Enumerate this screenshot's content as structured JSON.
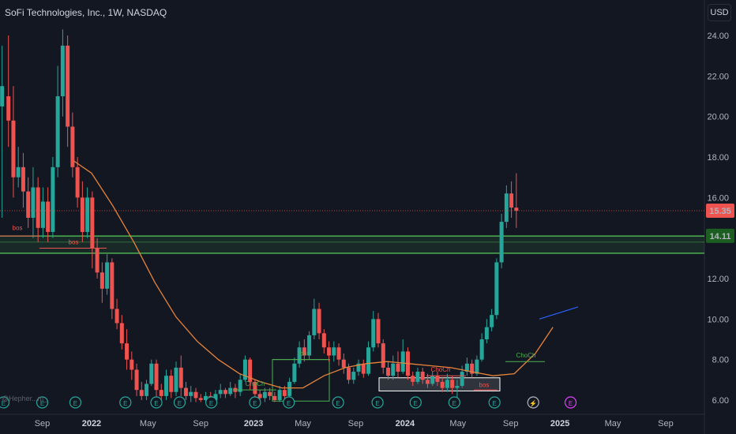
{
  "header": {
    "title": "SoFi Technologies, Inc., 1W, NASDAQ",
    "currency": "USD"
  },
  "watermark": "@Hepher...m_",
  "colors": {
    "background": "#131722",
    "up": "#26a69a",
    "down": "#ef5350",
    "ma": "#e8843a",
    "zone": "#4caf50",
    "price_line": "#ef5350"
  },
  "chart_data": {
    "type": "candlestick",
    "title": "SoFi Technologies, Inc., 1W, NASDAQ",
    "ylabel": "USD",
    "ylim": [
      5.8,
      25
    ],
    "y_ticks": [
      "24.00",
      "22.00",
      "20.00",
      "18.00",
      "16.00",
      "14.00",
      "12.00",
      "10.00",
      "8.00",
      "6.00"
    ],
    "x_ticks": [
      {
        "label": "Sep",
        "t": 0.06
      },
      {
        "label": "2022",
        "t": 0.13,
        "year": true
      },
      {
        "label": "May",
        "t": 0.21
      },
      {
        "label": "Sep",
        "t": 0.285
      },
      {
        "label": "2023",
        "t": 0.36,
        "year": true
      },
      {
        "label": "May",
        "t": 0.43
      },
      {
        "label": "Sep",
        "t": 0.505
      },
      {
        "label": "2024",
        "t": 0.575,
        "year": true
      },
      {
        "label": "May",
        "t": 0.65
      },
      {
        "label": "Sep",
        "t": 0.725
      },
      {
        "label": "2025",
        "t": 0.795,
        "year": true
      },
      {
        "label": "May",
        "t": 0.87
      },
      {
        "label": "Sep",
        "t": 0.945
      }
    ],
    "last_price": "15.35",
    "level_price": "14.11",
    "levels": [
      {
        "label": "15.35",
        "value": 15.35,
        "color": "#ef5350"
      },
      {
        "label": "14.11",
        "value": 14.11,
        "color": "#1b5e20"
      }
    ],
    "zone": {
      "from": 13.25,
      "to": 14.1
    },
    "annotations": [
      "bos",
      "bos",
      "ChoCh",
      "bos",
      "ChoCh",
      "ChoCh",
      "bos"
    ],
    "earnings_marker": "E",
    "ma": {
      "name": "",
      "points": [
        [
          0.105,
          17.8
        ],
        [
          0.13,
          17.2
        ],
        [
          0.16,
          15.6
        ],
        [
          0.19,
          13.8
        ],
        [
          0.22,
          11.8
        ],
        [
          0.25,
          10.1
        ],
        [
          0.28,
          8.9
        ],
        [
          0.31,
          8.0
        ],
        [
          0.34,
          7.3
        ],
        [
          0.37,
          6.9
        ],
        [
          0.4,
          6.6
        ],
        [
          0.43,
          6.6
        ],
        [
          0.46,
          7.2
        ],
        [
          0.49,
          7.6
        ],
        [
          0.52,
          7.8
        ],
        [
          0.55,
          7.9
        ],
        [
          0.58,
          7.8
        ],
        [
          0.61,
          7.7
        ],
        [
          0.64,
          7.6
        ],
        [
          0.67,
          7.4
        ],
        [
          0.7,
          7.2
        ],
        [
          0.73,
          7.3
        ],
        [
          0.76,
          8.3
        ],
        [
          0.785,
          9.6
        ]
      ]
    },
    "candles": [
      [
        0.003,
        20.5,
        21.5,
        15.0,
        23.5
      ],
      [
        0.012,
        21.0,
        19.8,
        18.5,
        24.0
      ],
      [
        0.019,
        19.8,
        17.0,
        16.0,
        21.5
      ],
      [
        0.026,
        17.0,
        17.5,
        16.5,
        18.5
      ],
      [
        0.033,
        17.5,
        16.3,
        15.5,
        18.2
      ],
      [
        0.04,
        16.3,
        15.0,
        14.5,
        17.0
      ],
      [
        0.047,
        15.0,
        16.5,
        14.0,
        17.5
      ],
      [
        0.054,
        16.5,
        14.5,
        13.8,
        17.0
      ],
      [
        0.061,
        14.5,
        15.8,
        14.0,
        16.5
      ],
      [
        0.068,
        15.8,
        14.3,
        13.8,
        16.5
      ],
      [
        0.075,
        14.3,
        17.5,
        14.0,
        18.0
      ],
      [
        0.082,
        17.5,
        21.0,
        17.0,
        22.5
      ],
      [
        0.089,
        21.0,
        23.5,
        20.0,
        24.3
      ],
      [
        0.096,
        23.5,
        19.5,
        18.5,
        24.0
      ],
      [
        0.103,
        19.5,
        17.5,
        17.0,
        20.2
      ],
      [
        0.11,
        17.5,
        16.0,
        15.5,
        18.0
      ],
      [
        0.117,
        16.0,
        14.3,
        13.8,
        16.8
      ],
      [
        0.124,
        14.3,
        16.0,
        14.0,
        16.5
      ],
      [
        0.131,
        16.0,
        13.5,
        12.5,
        16.3
      ],
      [
        0.138,
        13.5,
        12.3,
        12.0,
        14.0
      ],
      [
        0.145,
        12.3,
        11.5,
        10.8,
        12.8
      ],
      [
        0.152,
        11.5,
        12.8,
        11.2,
        13.2
      ],
      [
        0.159,
        12.8,
        10.5,
        10.0,
        13.0
      ],
      [
        0.166,
        10.5,
        9.8,
        9.5,
        11.0
      ],
      [
        0.173,
        9.8,
        8.8,
        8.5,
        10.2
      ],
      [
        0.18,
        8.8,
        8.0,
        7.5,
        9.5
      ],
      [
        0.187,
        8.0,
        7.5,
        7.0,
        8.4
      ],
      [
        0.194,
        7.5,
        6.5,
        6.2,
        7.8
      ],
      [
        0.201,
        6.5,
        6.2,
        6.0,
        6.9
      ],
      [
        0.208,
        6.2,
        6.8,
        6.0,
        7.0
      ],
      [
        0.215,
        6.8,
        7.8,
        6.7,
        8.0
      ],
      [
        0.222,
        7.8,
        6.5,
        6.1,
        8.0
      ],
      [
        0.229,
        6.5,
        6.2,
        6.0,
        6.8
      ],
      [
        0.236,
        6.2,
        7.2,
        6.0,
        7.5
      ],
      [
        0.243,
        7.2,
        6.4,
        6.1,
        7.5
      ],
      [
        0.25,
        6.4,
        7.6,
        6.2,
        7.9
      ],
      [
        0.257,
        7.6,
        6.6,
        6.2,
        8.2
      ],
      [
        0.264,
        6.6,
        6.2,
        6.0,
        6.9
      ],
      [
        0.271,
        6.2,
        6.4,
        5.9,
        6.7
      ],
      [
        0.278,
        6.4,
        6.1,
        5.9,
        6.6
      ],
      [
        0.285,
        6.1,
        6.0,
        5.9,
        6.3
      ],
      [
        0.292,
        6.0,
        6.2,
        5.9,
        6.4
      ],
      [
        0.299,
        6.2,
        6.0,
        5.9,
        6.4
      ],
      [
        0.306,
        6.0,
        6.3,
        5.9,
        6.5
      ],
      [
        0.313,
        6.3,
        6.5,
        6.1,
        6.8
      ],
      [
        0.32,
        6.5,
        6.3,
        6.1,
        6.6
      ],
      [
        0.327,
        6.3,
        6.6,
        6.2,
        6.9
      ],
      [
        0.334,
        6.6,
        6.4,
        6.1,
        6.8
      ],
      [
        0.341,
        6.4,
        7.0,
        6.2,
        7.3
      ],
      [
        0.348,
        7.0,
        8.0,
        6.9,
        8.2
      ],
      [
        0.355,
        8.0,
        6.9,
        6.5,
        8.1
      ],
      [
        0.362,
        6.9,
        6.3,
        6.0,
        7.0
      ],
      [
        0.369,
        6.3,
        6.1,
        5.9,
        6.5
      ],
      [
        0.376,
        6.1,
        6.4,
        5.9,
        6.6
      ],
      [
        0.383,
        6.4,
        6.2,
        6.0,
        6.6
      ],
      [
        0.39,
        6.2,
        6.0,
        5.9,
        6.4
      ],
      [
        0.397,
        6.0,
        6.5,
        5.9,
        6.7
      ],
      [
        0.404,
        6.5,
        6.2,
        6.0,
        6.7
      ],
      [
        0.411,
        6.2,
        6.9,
        6.1,
        7.1
      ],
      [
        0.418,
        6.9,
        7.8,
        6.8,
        8.1
      ],
      [
        0.425,
        7.8,
        8.6,
        7.6,
        8.9
      ],
      [
        0.432,
        8.6,
        8.2,
        7.9,
        9.0
      ],
      [
        0.439,
        8.2,
        9.2,
        8.0,
        9.4
      ],
      [
        0.446,
        9.2,
        10.5,
        9.0,
        11.0
      ],
      [
        0.453,
        10.5,
        9.3,
        9.0,
        10.8
      ],
      [
        0.46,
        9.3,
        8.6,
        8.3,
        9.5
      ],
      [
        0.467,
        8.6,
        8.2,
        7.9,
        8.9
      ],
      [
        0.474,
        8.2,
        8.6,
        7.9,
        8.9
      ],
      [
        0.481,
        8.6,
        8.0,
        7.7,
        8.8
      ],
      [
        0.488,
        8.0,
        7.6,
        7.3,
        8.3
      ],
      [
        0.495,
        7.6,
        7.0,
        6.8,
        7.8
      ],
      [
        0.502,
        7.0,
        7.4,
        6.8,
        7.6
      ],
      [
        0.509,
        7.4,
        7.8,
        7.2,
        8.0
      ],
      [
        0.516,
        7.8,
        7.3,
        7.1,
        8.0
      ],
      [
        0.523,
        7.3,
        8.6,
        7.2,
        8.9
      ],
      [
        0.53,
        8.6,
        10.0,
        8.4,
        10.4
      ],
      [
        0.537,
        10.0,
        8.8,
        8.6,
        10.3
      ],
      [
        0.544,
        8.8,
        7.6,
        7.3,
        9.0
      ],
      [
        0.551,
        7.6,
        7.2,
        7.0,
        7.9
      ],
      [
        0.558,
        7.2,
        7.8,
        7.0,
        8.2
      ],
      [
        0.565,
        7.8,
        7.4,
        7.1,
        8.4
      ],
      [
        0.572,
        7.4,
        8.4,
        7.3,
        9.0
      ],
      [
        0.579,
        8.4,
        7.2,
        7.0,
        8.6
      ],
      [
        0.586,
        7.2,
        6.9,
        6.7,
        7.4
      ],
      [
        0.593,
        6.9,
        7.4,
        6.8,
        7.6
      ],
      [
        0.6,
        7.4,
        7.0,
        6.8,
        7.6
      ],
      [
        0.607,
        7.0,
        6.8,
        6.6,
        7.3
      ],
      [
        0.614,
        6.8,
        7.2,
        6.7,
        7.4
      ],
      [
        0.621,
        7.2,
        6.9,
        6.7,
        7.4
      ],
      [
        0.628,
        6.9,
        6.6,
        6.4,
        7.1
      ],
      [
        0.635,
        6.6,
        7.0,
        6.4,
        7.3
      ],
      [
        0.642,
        7.0,
        6.6,
        6.3,
        7.2
      ],
      [
        0.649,
        6.6,
        6.7,
        6.1,
        7.0
      ],
      [
        0.656,
        6.7,
        7.4,
        6.6,
        7.7
      ],
      [
        0.663,
        7.4,
        7.8,
        7.2,
        8.1
      ],
      [
        0.67,
        7.8,
        7.3,
        7.1,
        8.0
      ],
      [
        0.677,
        7.3,
        8.0,
        7.2,
        8.2
      ],
      [
        0.684,
        8.0,
        9.0,
        7.9,
        9.3
      ],
      [
        0.691,
        9.0,
        9.6,
        8.8,
        10.0
      ],
      [
        0.698,
        9.6,
        10.2,
        9.4,
        10.5
      ],
      [
        0.705,
        10.2,
        12.8,
        10.0,
        13.0
      ],
      [
        0.712,
        12.8,
        14.8,
        12.5,
        15.2
      ],
      [
        0.719,
        14.8,
        16.2,
        14.5,
        16.6
      ],
      [
        0.726,
        16.2,
        15.5,
        15.0,
        16.8
      ],
      [
        0.733,
        15.5,
        15.35,
        14.5,
        17.2
      ]
    ]
  }
}
